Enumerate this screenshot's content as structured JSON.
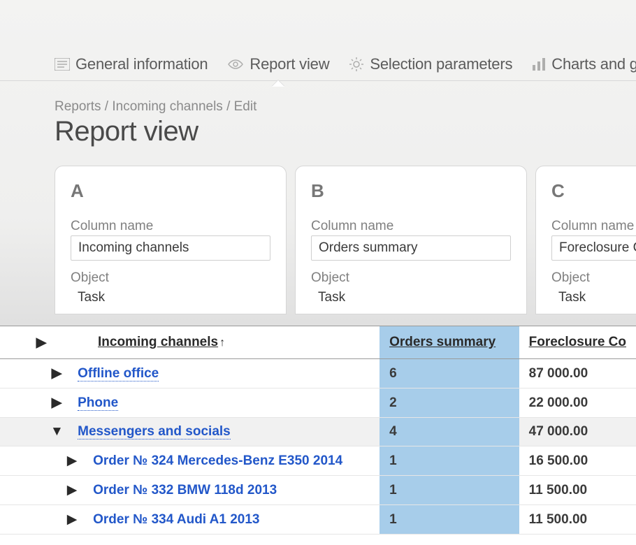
{
  "tabs": [
    {
      "label": "General information"
    },
    {
      "label": "Report view"
    },
    {
      "label": "Selection parameters"
    },
    {
      "label": "Charts and gr"
    }
  ],
  "breadcrumb": "Reports / Incoming channels / Edit",
  "page_title": "Report view",
  "columns": [
    {
      "letter": "A",
      "name_label": "Column name",
      "name_value": "Incoming channels",
      "object_label": "Object",
      "object_value": "Task"
    },
    {
      "letter": "B",
      "name_label": "Column name",
      "name_value": "Orders summary",
      "object_label": "Object",
      "object_value": "Task"
    },
    {
      "letter": "C",
      "name_label": "Column name",
      "name_value": "Foreclosure Co",
      "object_label": "Object",
      "object_value": "Task"
    }
  ],
  "table": {
    "headers": {
      "incoming": "Incoming channels",
      "sort_indicator": "↑",
      "summary": "Orders summary",
      "foreclosure": "Foreclosure Co"
    },
    "rows": [
      {
        "type": "group",
        "expanded": false,
        "label": "Offline office",
        "summary": "6",
        "foreclosure": "87 000.00"
      },
      {
        "type": "group",
        "expanded": false,
        "label": "Phone",
        "summary": "2",
        "foreclosure": "22 000.00"
      },
      {
        "type": "group",
        "expanded": true,
        "label": "Messengers and socials",
        "summary": "4",
        "foreclosure": "47 000.00"
      },
      {
        "type": "child",
        "label": "Order № 324 Mercedes-Benz E350 2014",
        "summary": "1",
        "foreclosure": "16 500.00"
      },
      {
        "type": "child",
        "label": "Order № 332 BMW 118d 2013",
        "summary": "1",
        "foreclosure": "11 500.00"
      },
      {
        "type": "child",
        "label": "Order № 334 Audi A1 2013",
        "summary": "1",
        "foreclosure": "11 500.00"
      }
    ]
  }
}
